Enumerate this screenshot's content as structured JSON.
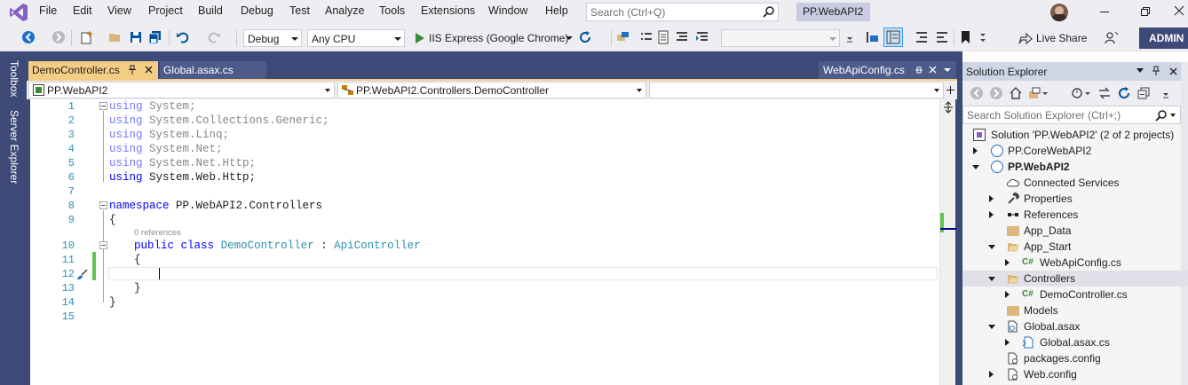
{
  "menu": {
    "items": [
      "File",
      "Edit",
      "View",
      "Project",
      "Build",
      "Debug",
      "Test",
      "Analyze",
      "Tools",
      "Extensions",
      "Window",
      "Help"
    ]
  },
  "search": {
    "placeholder": "Search (Ctrl+Q)"
  },
  "solution_name": "PP.WebAPI2",
  "user": {
    "badge": "ADMIN"
  },
  "toolbar": {
    "config": "Debug",
    "platform": "Any CPU",
    "run_target": "IIS Express (Google Chrome)",
    "live_share": "Live Share"
  },
  "left_strip": {
    "toolbox": "Toolbox",
    "server_explorer": "Server Explorer"
  },
  "tabs": {
    "active": "DemoController.cs",
    "second": "Global.asax.cs",
    "right": "WebApiConfig.cs"
  },
  "navbar": {
    "project": "PP.WebAPI2",
    "class": "PP.WebAPI2.Controllers.DemoController",
    "member": ""
  },
  "code": {
    "line_numbers": [
      "1",
      "2",
      "3",
      "4",
      "5",
      "6",
      "7",
      "8",
      "9",
      "10",
      "11",
      "12",
      "13",
      "14",
      "15"
    ],
    "lines": [
      {
        "kw": "using",
        "rest": " System;"
      },
      {
        "kw": "using",
        "rest": " System.Collections.Generic;"
      },
      {
        "kw": "using",
        "rest": " System.Linq;"
      },
      {
        "kw": "using",
        "rest": " System.Net;"
      },
      {
        "kw": "using",
        "rest": " System.Net.Http;"
      },
      {
        "kw": "using",
        "rest": " System.Web.Http;"
      }
    ],
    "namespace_kw": "namespace",
    "namespace_name": " PP.WebAPI2.Controllers",
    "open_brace": "{",
    "codelens": "0 references",
    "public_kw": "public",
    "class_kw": "class",
    "class_name": "DemoController",
    "colon": " : ",
    "base_class": "ApiController",
    "close_brace": "}"
  },
  "solution_explorer": {
    "title": "Solution Explorer",
    "search_placeholder": "Search Solution Explorer (Ctrl+;)",
    "items": [
      {
        "label": "Solution 'PP.WebAPI2' (2 of 2 projects)",
        "icon": "solution-icon"
      },
      {
        "label": "PP.CoreWebAPI2",
        "icon": "web-project-icon"
      },
      {
        "label": "PP.WebAPI2",
        "icon": "web-project-icon"
      },
      {
        "label": "Connected Services",
        "icon": "cloud-icon"
      },
      {
        "label": "Properties",
        "icon": "wrench-icon"
      },
      {
        "label": "References",
        "icon": "references-icon"
      },
      {
        "label": "App_Data",
        "icon": "folder-icon"
      },
      {
        "label": "App_Start",
        "icon": "folder-open-icon"
      },
      {
        "label": "WebApiConfig.cs",
        "icon": "csharp-file-icon"
      },
      {
        "label": "Controllers",
        "icon": "folder-open-icon"
      },
      {
        "label": "DemoController.cs",
        "icon": "csharp-file-icon"
      },
      {
        "label": "Models",
        "icon": "folder-icon"
      },
      {
        "label": "Global.asax",
        "icon": "asax-icon"
      },
      {
        "label": "Global.asax.cs",
        "icon": "file-icon"
      },
      {
        "label": "packages.config",
        "icon": "config-icon"
      },
      {
        "label": "Web.config",
        "icon": "config-icon"
      }
    ]
  },
  "colors": {
    "frame": "#3d4a77",
    "active_tab": "#f5cc84",
    "keyword": "#0000ff",
    "type": "#2b91af",
    "change_marker": "#5ec44e"
  }
}
